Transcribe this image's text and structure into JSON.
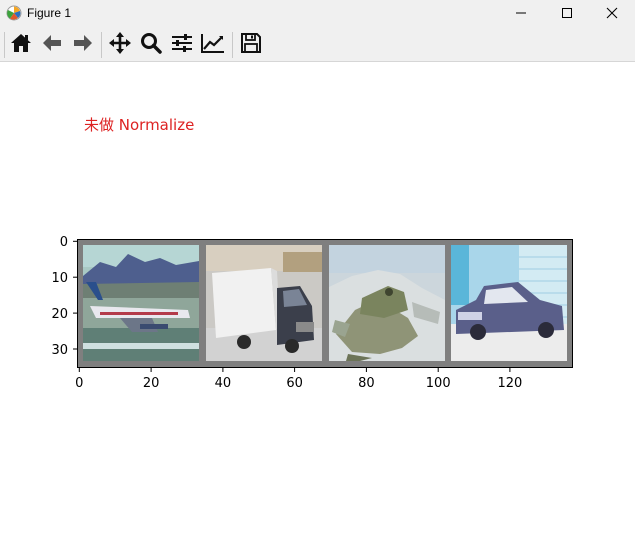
{
  "window": {
    "title": "Figure 1",
    "icon": "matplotlib-logo-icon"
  },
  "window_controls": [
    "minimize-icon",
    "maximize-icon",
    "close-icon"
  ],
  "toolbar": {
    "buttons": [
      {
        "name": "home",
        "icon": "home-icon"
      },
      {
        "name": "back",
        "icon": "arrow-left-icon"
      },
      {
        "name": "forward",
        "icon": "arrow-right-icon"
      },
      {
        "name": "pan",
        "icon": "move-icon"
      },
      {
        "name": "zoom",
        "icon": "magnifier-icon"
      },
      {
        "name": "subplots",
        "icon": "sliders-icon"
      },
      {
        "name": "axes-edit",
        "icon": "line-chart-icon"
      },
      {
        "name": "save",
        "icon": "floppy-disk-icon"
      }
    ]
  },
  "figure": {
    "annotation": "未做 Normalize",
    "annotation_color": "#dd2222"
  },
  "chart_data": {
    "type": "image",
    "x_ticks": [
      "0",
      "20",
      "40",
      "60",
      "80",
      "100",
      "120"
    ],
    "y_ticks": [
      "0",
      "10",
      "20",
      "30"
    ],
    "xlim": [
      -0.5,
      137.5
    ],
    "ylim": [
      35.5,
      -0.5
    ],
    "grid_border_color": "#7f7f7f",
    "tiles": [
      {
        "subject": "airplane",
        "x_range": [
          2,
          34
        ]
      },
      {
        "subject": "truck",
        "x_range": [
          36,
          68
        ]
      },
      {
        "subject": "frog",
        "x_range": [
          70,
          102
        ]
      },
      {
        "subject": "car",
        "x_range": [
          104,
          136
        ]
      }
    ]
  }
}
